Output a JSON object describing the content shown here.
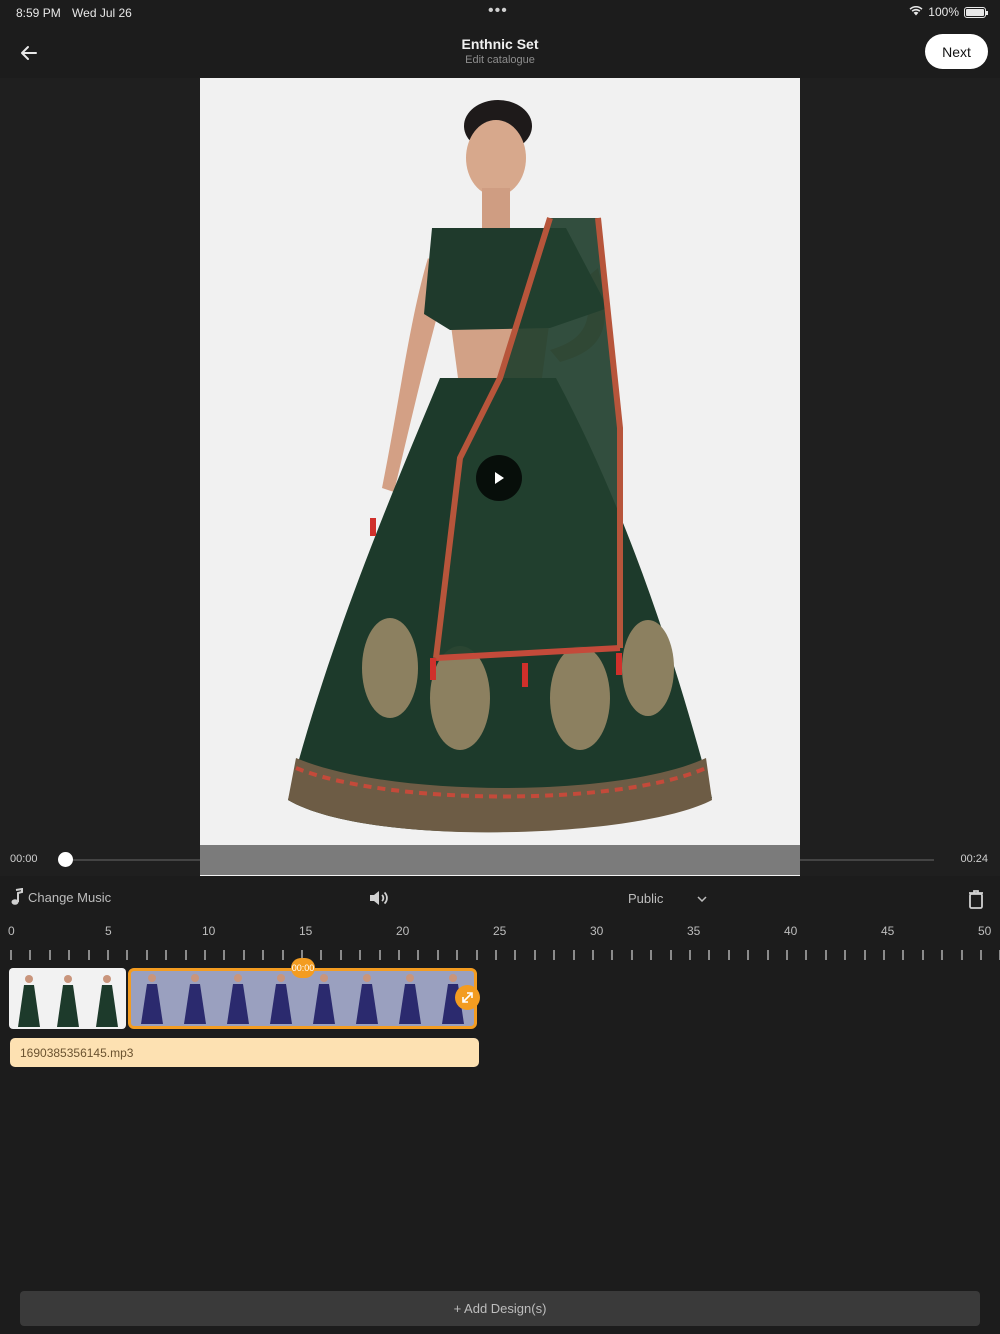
{
  "status_bar": {
    "time": "8:59 PM",
    "date": "Wed Jul 26",
    "battery": "100%",
    "multitask_dots": "•••"
  },
  "header": {
    "title": "Enthnic Set",
    "subtitle": "Edit catalogue",
    "next_label": "Next"
  },
  "player": {
    "current_time": "00:00",
    "total_time": "00:24",
    "progress": 0
  },
  "toolbar": {
    "change_music_label": "Change Music",
    "visibility_value": "Public"
  },
  "timeline": {
    "ruler_labels": [
      "0",
      "5",
      "10",
      "15",
      "20",
      "25",
      "30",
      "35",
      "40",
      "45",
      "50"
    ],
    "clip_badge": "00:00",
    "audio_file": "1690385356145.mp3"
  },
  "footer": {
    "add_designs_label": "+ Add Design(s)"
  },
  "colors": {
    "accent": "#f39c21",
    "audio_track": "#fde1b2",
    "background": "#1c1c1c"
  }
}
